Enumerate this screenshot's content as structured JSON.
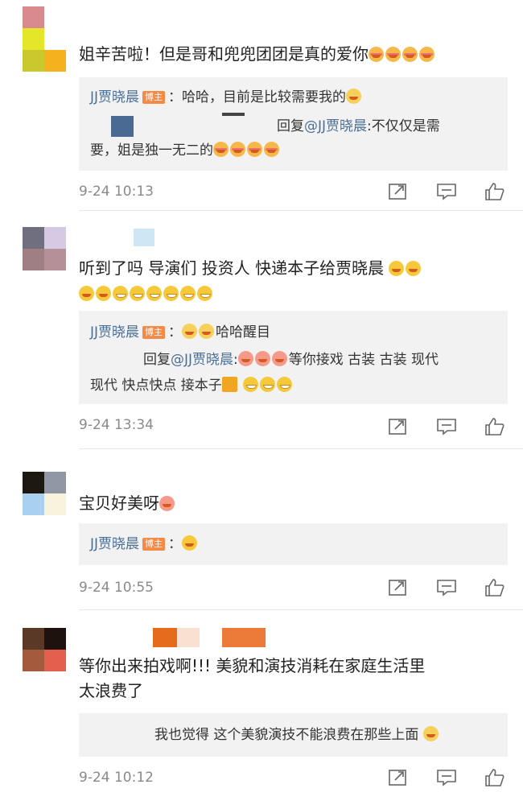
{
  "comments": [
    {
      "text": "姐辛苦啦！但是哥和兜兜团团是真的爱你",
      "reply_author": "JJ贾晓晨",
      "reply_badge": "博主",
      "reply_text": "：哈哈，目前是比较需要我的",
      "sub_reply_prefix": "回复",
      "sub_reply_mention": "@JJ贾晓晨",
      "sub_reply_text": ":不仅仅是需",
      "sub_reply_text2": "要，姐是独一无二的",
      "time": "9-24 10:13"
    },
    {
      "text": "听到了吗 导演们 投资人  快递本子给贾晓晨",
      "reply_author": "JJ贾晓晨",
      "reply_badge": "博主",
      "reply_text": "哈哈醒目",
      "sub_reply_prefix": "回复",
      "sub_reply_mention": "@JJ贾晓晨",
      "sub_reply_text": "等你接戏  古装  古装  现代",
      "sub_reply_text2": "现代  快点快点  接本子",
      "time": "9-24 13:34"
    },
    {
      "text": "宝贝好美呀",
      "reply_author": "JJ贾晓晨",
      "reply_badge": "博主",
      "reply_text": "：",
      "time": "9-24 10:55"
    },
    {
      "text": "等你出来拍戏啊!!!  美貌和演技消耗在家庭生活里",
      "text2": "太浪费了",
      "reply_text": "我也觉得  这个美貌演技不能浪费在那些上面",
      "time": "9-24 10:12"
    }
  ],
  "icons": {
    "share": "share-icon",
    "comment": "comment-icon",
    "like": "like-icon"
  },
  "colors": {
    "author": "#4a6f97",
    "badge": "#f38a45",
    "time": "#8a8a8a",
    "reply_bg": "#f2f2f2"
  }
}
